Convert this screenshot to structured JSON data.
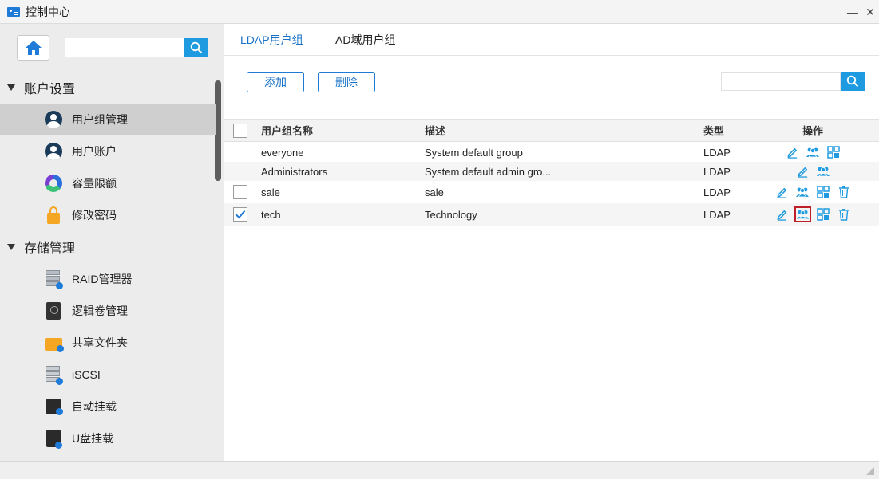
{
  "window": {
    "title": "控制中心",
    "minimize_glyph": "—",
    "close_glyph": "✕"
  },
  "sidebar": {
    "search": {
      "placeholder": "",
      "value": ""
    },
    "sections": [
      {
        "label": "账户设置",
        "items": [
          {
            "label": "用户组管理",
            "icon": "group-user-icon",
            "active": true
          },
          {
            "label": "用户账户",
            "icon": "user-account-icon"
          },
          {
            "label": "容量限额",
            "icon": "quota-icon"
          },
          {
            "label": "修改密码",
            "icon": "lock-icon"
          }
        ]
      },
      {
        "label": "存储管理",
        "items": [
          {
            "label": "RAID管理器",
            "icon": "raid-icon"
          },
          {
            "label": "逻辑卷管理",
            "icon": "lvm-icon"
          },
          {
            "label": "共享文件夹",
            "icon": "shared-folder-icon"
          },
          {
            "label": "iSCSI",
            "icon": "iscsi-icon"
          },
          {
            "label": "自动挂载",
            "icon": "auto-mount-icon"
          },
          {
            "label": "U盘挂载",
            "icon": "usb-mount-icon"
          }
        ]
      }
    ]
  },
  "main": {
    "tabs": [
      {
        "label": "LDAP用户组",
        "active": true
      },
      {
        "label": "AD域用户组",
        "active": false
      }
    ],
    "toolbar": {
      "add_label": "添加",
      "delete_label": "删除",
      "search_placeholder": "",
      "search_value": ""
    },
    "table": {
      "columns": [
        "用户组名称",
        "描述",
        "类型",
        "操作"
      ],
      "rows": [
        {
          "name": "everyone",
          "description": "System default group",
          "type": "LDAP",
          "checkbox": false,
          "checked": false,
          "ops": [
            "edit",
            "members",
            "permissions"
          ]
        },
        {
          "name": "Administrators",
          "description": "System default admin gro...",
          "type": "LDAP",
          "checkbox": false,
          "checked": false,
          "ops": [
            "edit",
            "members"
          ]
        },
        {
          "name": "sale",
          "description": "sale",
          "type": "LDAP",
          "checkbox": true,
          "checked": false,
          "ops": [
            "edit",
            "members",
            "permissions",
            "delete"
          ]
        },
        {
          "name": "tech",
          "description": "Technology",
          "type": "LDAP",
          "checkbox": true,
          "checked": true,
          "ops": [
            "edit",
            "members",
            "permissions",
            "delete"
          ],
          "highlighted_op": "members"
        }
      ]
    }
  },
  "colors": {
    "accent": "#1e9be0",
    "link": "#1a73c8",
    "highlight_border": "#c0202a",
    "sidebar_bg": "#ececec",
    "active_item_bg": "#cfcfcf"
  }
}
